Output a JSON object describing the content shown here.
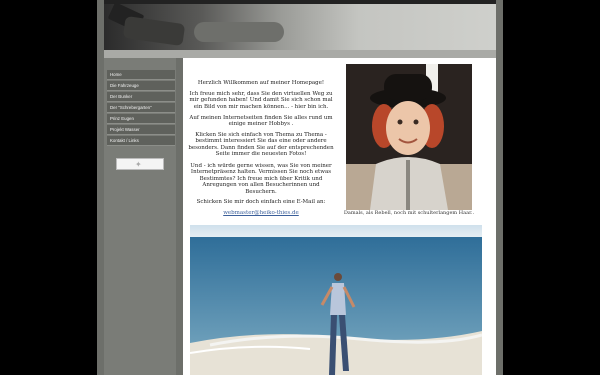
{
  "nav": {
    "items": [
      {
        "label": "Home"
      },
      {
        "label": "Die Fahrzeuge"
      },
      {
        "label": "Der Bunker"
      },
      {
        "label": "Der \"Schrebergarten\""
      },
      {
        "label": "Prinz Eugen"
      },
      {
        "label": "Projekt Wasser"
      },
      {
        "label": "Kontakt / Links"
      }
    ]
  },
  "content": {
    "welcome": "Herzlich Willkommen auf meiner Homepage!",
    "para1": "Ich freue mich sehr, dass Sie den virtuellen Weg zu mir gefunden haben! Und damit Sie sich schon mal ein Bild von mir machen können... - hier bin ich.",
    "para2": "Auf meinen Internetseiten finden Sie alles rund um einige meiner Hobbys .",
    "para3": "Klicken Sie sich einfach von Thema zu Thema - bestimmt interessiert Sie das eine oder andere besonders. Dann finden Sie auf der entsprechenden Seite immer die neuesten Fotos!",
    "para4": "Und - ich würde gerne wissen, was Sie von meiner Internetpräsenz halten. Vermissen Sie noch etwas Bestimmtes? Ich freue mich über Kritik und Anregungen von allen Besucherinnen und Besuchern.",
    "para5": "Schicken Sie mir doch einfach eine E-Mail an:",
    "email": "webmaster@heiko-thies.de",
    "caption": "Damals, als Rebell, noch mit schulterlangem Haar.."
  }
}
